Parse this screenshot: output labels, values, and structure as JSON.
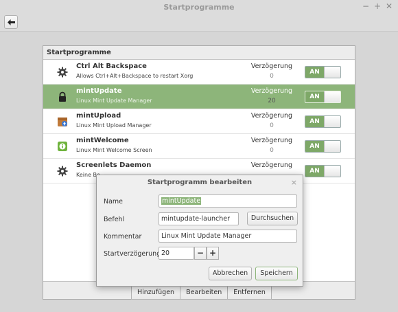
{
  "window": {
    "title": "Startprogramme",
    "controls": [
      "−",
      "+",
      "✕"
    ],
    "back_icon": "back-arrow-icon"
  },
  "panel": {
    "header": "Startprogramme",
    "rows": [
      {
        "name": "Ctrl Alt Backspace",
        "desc": "Allows Ctrl+Alt+Backspace to restart Xorg",
        "delay_label": "Verzögerung",
        "delay": "0",
        "toggle": "AN",
        "icon": "gear-icon"
      },
      {
        "name": "mintUpdate",
        "desc": "Linux Mint Update Manager",
        "delay_label": "Verzögerung",
        "delay": "20",
        "toggle": "AN",
        "icon": "lock-icon"
      },
      {
        "name": "mintUpload",
        "desc": "Linux Mint Upload Manager",
        "delay_label": "Verzögerung",
        "delay": "0",
        "toggle": "AN",
        "icon": "upload-box-icon"
      },
      {
        "name": "mintWelcome",
        "desc": "Linux Mint Welcome Screen",
        "delay_label": "Verzögerung",
        "delay": "0",
        "toggle": "AN",
        "icon": "info-icon"
      },
      {
        "name": "Screenlets Daemon",
        "desc": "Keine Be",
        "delay_label": "Verzögerung",
        "delay": "",
        "toggle": "AN",
        "icon": "gear-icon"
      }
    ],
    "footer_buttons": [
      "Hinzufügen",
      "Bearbeiten",
      "Entfernen"
    ]
  },
  "dialog": {
    "title": "Startprogramm bearbeiten",
    "close": "×",
    "name_label": "Name",
    "name_value": "mintUpdate",
    "command_label": "Befehl",
    "command_value": "mintupdate-launcher",
    "browse_label": "Durchsuchen ...",
    "comment_label": "Kommentar",
    "comment_value": "Linux Mint Update Manager",
    "delay_label": "Startverzögerung",
    "delay_value": "20",
    "minus": "−",
    "plus": "+",
    "cancel_label": "Abbrechen",
    "save_label": "Speichern"
  },
  "colors": {
    "accent": "#8db57a",
    "toggle_on": "#7ea868"
  }
}
